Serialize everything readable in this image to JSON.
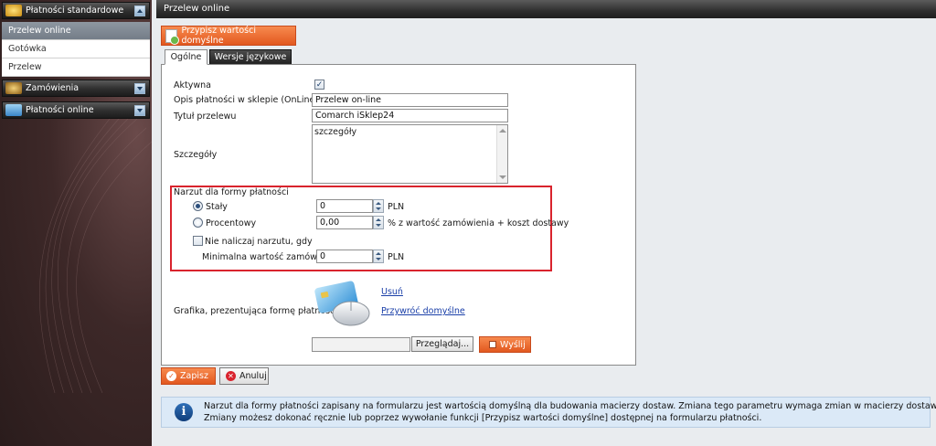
{
  "sidebar": {
    "sections": [
      {
        "label": "Płatności standardowe"
      },
      {
        "label": "Zamówienia"
      },
      {
        "label": "Płatności online"
      }
    ],
    "items": [
      {
        "label": "Przelew online"
      },
      {
        "label": "Gotówka"
      },
      {
        "label": "Przelew"
      }
    ]
  },
  "header": {
    "title": "Przelew online"
  },
  "toolbar": {
    "defaults_label": "Przypisz wartości domyślne"
  },
  "tabs": [
    {
      "label": "Ogólne"
    },
    {
      "label": "Wersje językowe"
    }
  ],
  "form": {
    "active_label": "Aktywna",
    "active_mark": "✓",
    "desc_label": "Opis płatności w sklepie (OnLine)",
    "desc_value": "Przelew on-line",
    "title_label": "Tytuł przelewu",
    "title_value": "Comarch iSklep24",
    "details_label": "Szczegóły",
    "details_value": "szczegóły",
    "surcharge": {
      "legend": "Narzut dla formy płatności",
      "fixed_label": "Stały",
      "fixed_value": "0",
      "fixed_unit": "PLN",
      "percent_label": "Procentowy",
      "percent_value": "0,00",
      "percent_unit": "% z wartość zamówienia + koszt dostawy",
      "no_charge_label": "Nie naliczaj narzutu, gdy",
      "min_label": "Minimalna wartość zamówienia",
      "min_value": "0",
      "min_unit": "PLN"
    },
    "graphic_label": "Grafika, prezentująca formę płatności",
    "remove_link": "Usuń",
    "restore_link": "Przywróć domyślne",
    "browse_label": "Przeglądaj...",
    "send_label": "Wyślij"
  },
  "actions": {
    "save_label": "Zapisz",
    "cancel_label": "Anuluj"
  },
  "info": {
    "icon_glyph": "i",
    "line1": "Narzut dla formy płatności zapisany na formularzu jest wartością domyślną dla budowania macierzy dostaw. Zmiana tego parametru wymaga zmian w macierzy dostaw.",
    "line2": "Zmiany możesz dokonać ręcznie lub poprzez wywołanie funkcji [Przypisz wartości domyślne] dostępnej na formularzu płatności."
  },
  "colors": {
    "accent_orange": "#e2581f",
    "highlight_red": "#d9232d",
    "link_blue": "#1a3fa8",
    "info_bg": "#dbe9f7"
  }
}
